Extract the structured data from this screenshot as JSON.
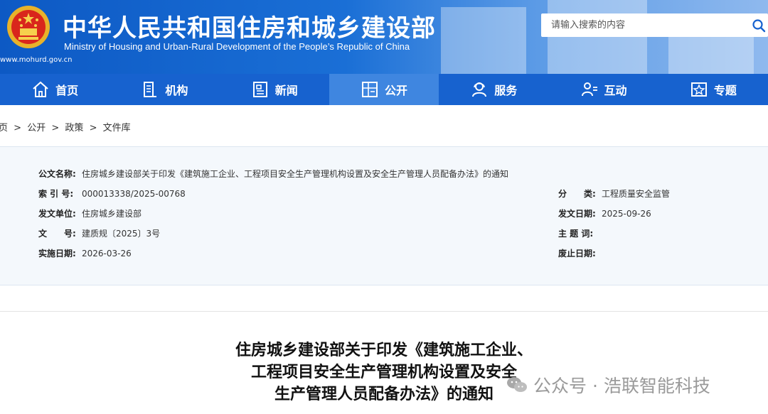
{
  "header": {
    "title_cn": "中华人民共和国住房和城乡建设部",
    "title_en": "Ministry of Housing and Urban-Rural Development of the People’s Republic of China",
    "domain": "www.mohurd.gov.cn",
    "search_placeholder": "请输入搜索的内容"
  },
  "nav": {
    "items": [
      {
        "label": "首页",
        "icon": "home-icon"
      },
      {
        "label": "机构",
        "icon": "building-icon"
      },
      {
        "label": "新闻",
        "icon": "news-icon"
      },
      {
        "label": "公开",
        "icon": "disclosure-icon",
        "active": true
      },
      {
        "label": "服务",
        "icon": "service-icon"
      },
      {
        "label": "互动",
        "icon": "interaction-icon"
      },
      {
        "label": "专题",
        "icon": "topic-icon"
      }
    ]
  },
  "breadcrumb": [
    "页",
    ">",
    "公开",
    ">",
    "政策",
    ">",
    "文件库"
  ],
  "info": {
    "name_label": "公文名称:",
    "name_value": "住房城乡建设部关于印发《建筑施工企业、工程项目安全生产管理机构设置及安全生产管理人员配备办法》的通知",
    "index_label": "索 引 号:",
    "index_value": "000013338/2025-00768",
    "category_label": "分　　类:",
    "category_value": "工程质量安全监管",
    "issuer_label": "发文单位:",
    "issuer_value": "住房城乡建设部",
    "issue_date_label": "发文日期:",
    "issue_date_value": "2025-09-26",
    "doc_no_label": "文　　号:",
    "doc_no_value": "建质规〔2025〕3号",
    "keywords_label": "主 题 词:",
    "keywords_value": "",
    "effective_label": "实施日期:",
    "effective_value": "2026-03-26",
    "expiry_label": "废止日期:",
    "expiry_value": ""
  },
  "article": {
    "title_lines": [
      "住房城乡建设部关于印发《建筑施工企业、",
      "工程项目安全生产管理机构设置及安全",
      "生产管理人员配备办法》的通知"
    ]
  },
  "watermark": {
    "text": "公众号 · 浩联智能科技"
  },
  "colors": {
    "header_blue": "#0d59c4",
    "nav_blue": "#1762cf",
    "nav_active": "#3f86e0",
    "info_bg": "#f4f8fc"
  }
}
